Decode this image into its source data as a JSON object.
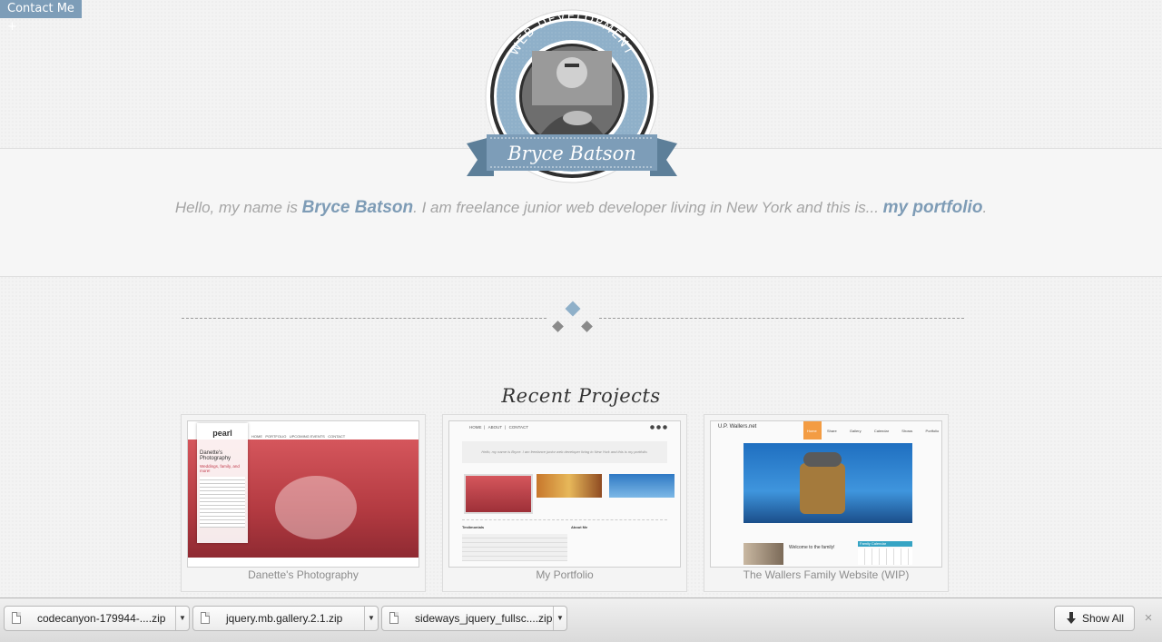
{
  "contact_tab": "Contact Me +",
  "badge": {
    "arc_text": "WEB DEVELOPMENT",
    "name": "Bryce Batson"
  },
  "intro": {
    "prefix": "Hello, my name is ",
    "name": "Bryce Batson",
    "middle": ". I am freelance junior web developer living in New York and this is... ",
    "link": "my portfolio",
    "suffix": "."
  },
  "section_title": "Recent Projects",
  "projects": [
    {
      "caption": "Danette's Photography",
      "thumb": {
        "logo": "pearl",
        "heading": "Danette's Photography",
        "tagline": "Weddings, family, and more!",
        "nav": [
          "HOME",
          "PORTFOLIO",
          "UPCOMING EVENTS",
          "CONTACT"
        ]
      }
    },
    {
      "caption": "My Portfolio",
      "thumb": {
        "nav": [
          "HOME",
          "ABOUT",
          "CONTACT"
        ],
        "intro": "Hello, my name is Bryce. I am freelance junior web developer living in New York and this is my portfolio.",
        "testimonials": "Testimonials",
        "about": "About Me"
      }
    },
    {
      "caption": "The Wallers Family Website (WIP)",
      "thumb": {
        "brand": "U.P. Wallers.net",
        "nav": [
          "Home",
          "Share",
          "Gallery",
          "Calendar",
          "Shows",
          "Portfolio"
        ],
        "welcome": "Welcome to the family!",
        "calendar": "Family Calendar"
      }
    }
  ],
  "downloads": {
    "items": [
      {
        "name": "codecanyon-179944-....zip"
      },
      {
        "name": "jquery.mb.gallery.2.1.zip"
      },
      {
        "name": "sideways_jquery_fullsc....zip"
      }
    ],
    "show_all": "Show All",
    "close": "×"
  },
  "colors": {
    "accent": "#7e9cb6",
    "badge_blue": "#8fb0c9",
    "ribbon": "#6f92ae",
    "diamond_blue": "#8fb0c9",
    "diamond_gray": "#8a8a8a"
  },
  "icons": {
    "download_arrow": "download-arrow-icon",
    "file": "file-icon",
    "close": "close-icon",
    "dropdown": "chevron-down-icon"
  }
}
